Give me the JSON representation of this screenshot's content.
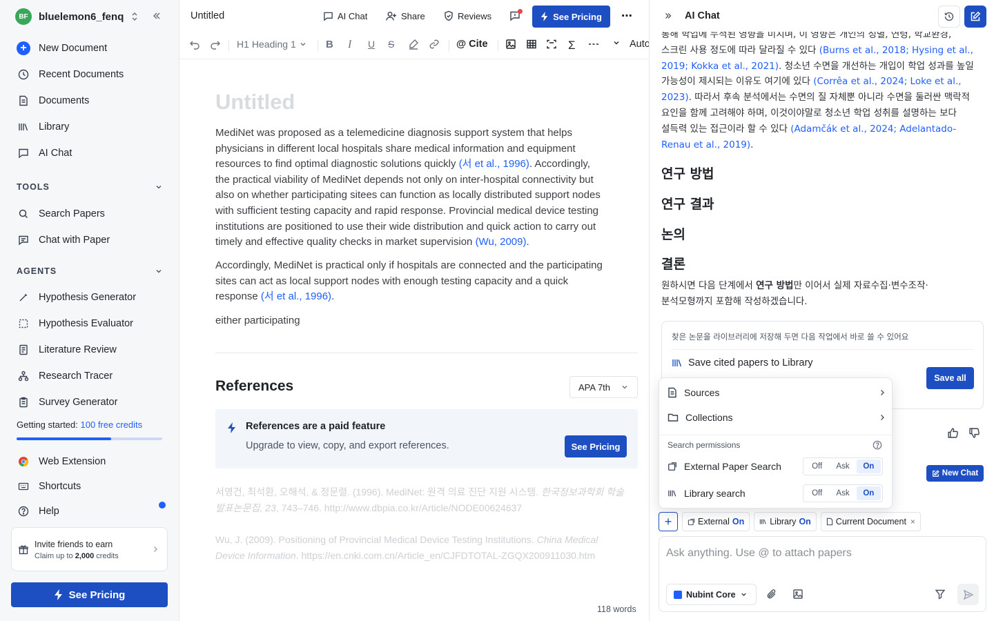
{
  "sidebar": {
    "avatar_initials": "BF",
    "workspace_name": "bluelemon6_fenq",
    "nav": [
      {
        "label": "New Document"
      },
      {
        "label": "Recent Documents"
      },
      {
        "label": "Documents"
      },
      {
        "label": "Library"
      },
      {
        "label": "AI Chat"
      }
    ],
    "tools_header": "TOOLS",
    "tools": [
      {
        "label": "Search Papers"
      },
      {
        "label": "Chat with Paper"
      }
    ],
    "agents_header": "AGENTS",
    "agents": [
      {
        "label": "Hypothesis Generator"
      },
      {
        "label": "Hypothesis Evaluator"
      },
      {
        "label": "Literature Review"
      },
      {
        "label": "Research Tracer"
      },
      {
        "label": "Survey Generator"
      }
    ],
    "credits_prefix": "Getting started:",
    "credits_link": "100 free credits",
    "credits_progress": 0.65,
    "bottom": [
      {
        "label": "Web Extension"
      },
      {
        "label": "Shortcuts"
      },
      {
        "label": "Help"
      }
    ],
    "invite_title": "Invite friends to earn",
    "invite_prefix": "Claim up to",
    "invite_amount": "2,000",
    "invite_suffix": "credits",
    "see_pricing": "See Pricing"
  },
  "editor": {
    "doc_title": "Untitled",
    "topbar": {
      "ai_chat": "AI Chat",
      "share": "Share",
      "reviews": "Reviews",
      "see_pricing": "See Pricing",
      "more": "⋯"
    },
    "toolbar": {
      "heading": "Heading 1",
      "heading_prefix": "H1",
      "cite": "Cite",
      "auto": "Auto"
    },
    "page_title": "Untitled",
    "paragraphs": {
      "p1_lines": [
        "MediNet was proposed as a telemedicine diagnosis support system that helps",
        "physicians in different local hospitals share medical information and equipment"
      ],
      "p1_line3_pre": "resources to find optimal diagnostic solutions quickly ",
      "p1_line3_cite": "(서 et al., 1996)",
      "p1_line3_post": ". Accordingly,",
      "p1_more": [
        "the practical viability of MediNet depends not only on inter-hospital connectivity but",
        "also on whether participating sitees can function as locally distributed support nodes",
        "with sufficient testing capacity and rapid response. Provincial medical device testing",
        "institutions are positioned to use their wide distribution and quick action to carry out"
      ],
      "p1_last_pre": "timely and effective quality checks in market supervision ",
      "p1_last_cite": "(Wu, 2009)",
      "p1_last_post": ".",
      "p2_lines": [
        "Accordingly, MediNet is practical only if hospitals are connected and the participating",
        "sites can act as local support nodes with enough testing capacity and a quick"
      ],
      "p2_last_pre": "response ",
      "p2_last_cite": "(서 et al., 1996)",
      "p2_last_post": ".",
      "p3": "either participating"
    },
    "references": {
      "title": "References",
      "style": "APA 7th",
      "paid_title": "References are a paid feature",
      "paid_sub": "Upgrade to view, copy, and export references.",
      "paid_btn": "See Pricing",
      "r1_line1_pre": "서영건, 최석환, 오해석, & 정문렬. (1996). MediNet: 원격 의료 진단 지원 시스템. ",
      "r1_line1_journal": "한국정보과학회 학술",
      "r1_line2_journal": "발표논문집, 23",
      "r1_line2_post": ", 743–746. http://www.dbpia.co.kr/Article/NODE00624637",
      "r2_line1_pre": "Wu, J. (2009). Positioning of Provincial Medical Device Testing Institutions. ",
      "r2_line1_journal": "China Medical",
      "r2_line2_journal": "Device Information",
      "r2_line2_post": ". https://en.cnki.com.cn/Article_en/CJFDTOTAL-ZGQX200911030.htm"
    },
    "word_count": "118 words"
  },
  "chat": {
    "title": "AI Chat",
    "body": {
      "l1": "통해 학업에 누적된 영향을 미치며, 이 영향은 개인의 성별, 연령, 학교환경,",
      "l2_pre": "스크린 사용 정도에 따라 달라질 수 있다 ",
      "l2_cite": "(Burns et al., 2018; Hysing et al.,",
      "l3_cite": "2019; Kokka et al., 2021)",
      "l3_post": ". 청소년 수면을 개선하는 개입이 학업 성과를 높일",
      "l4_pre": "가능성이 제시되는 이유도 여기에 있다 ",
      "l4_cite": "(Corrêa et al., 2024; Loke et al.,",
      "l5_cite": "2023)",
      "l5_post": ". 따라서 후속 분석에서는 수면의 질 자체뿐 아니라 수면을 둘러싼 맥락적",
      "l6": "요인을 함께 고려해야 하며, 이것이야말로 청소년 학업 성취를 설명하는 보다",
      "l7_pre": "설득력 있는 접근이라 할 수 있다 ",
      "l7_cite": "(Adamčák et al., 2024; Adelantado-",
      "l8_cite": "Renau et al., 2019)",
      "l8_post": "."
    },
    "headings": [
      "연구 방법",
      "연구 결과",
      "논의",
      "결론"
    ],
    "closing_pre": "원하시면 다음 단계에서 ",
    "closing_bold": "연구 방법",
    "closing_post": "만 이어서 실제 자료수집·변수조작·",
    "closing_l2": "분석모형까지 포함해 작성하겠습니다.",
    "save_card": {
      "hint": "찾은 논문을 라이브러리에 저장해 두면 다음 작업에서 바로 쓸 수 있어요",
      "label": "Save cited papers to Library",
      "button": "Save all"
    },
    "new_chat": "New Chat",
    "popup": {
      "sources": "Sources",
      "collections": "Collections",
      "permissions_title": "Search permissions",
      "rows": [
        {
          "label": "External Paper Search",
          "off": "Off",
          "ask": "Ask",
          "on": "On",
          "selected": "On"
        },
        {
          "label": "Library search",
          "off": "Off",
          "ask": "Ask",
          "on": "On",
          "selected": "On"
        }
      ]
    },
    "chips": {
      "plus": "+",
      "external": "External",
      "external_state": "On",
      "library": "Library",
      "library_state": "On",
      "current_doc": "Current Document",
      "remove": "×"
    },
    "input_placeholder": "Ask anything. Use @ to attach papers",
    "model": "Nubint Core"
  }
}
